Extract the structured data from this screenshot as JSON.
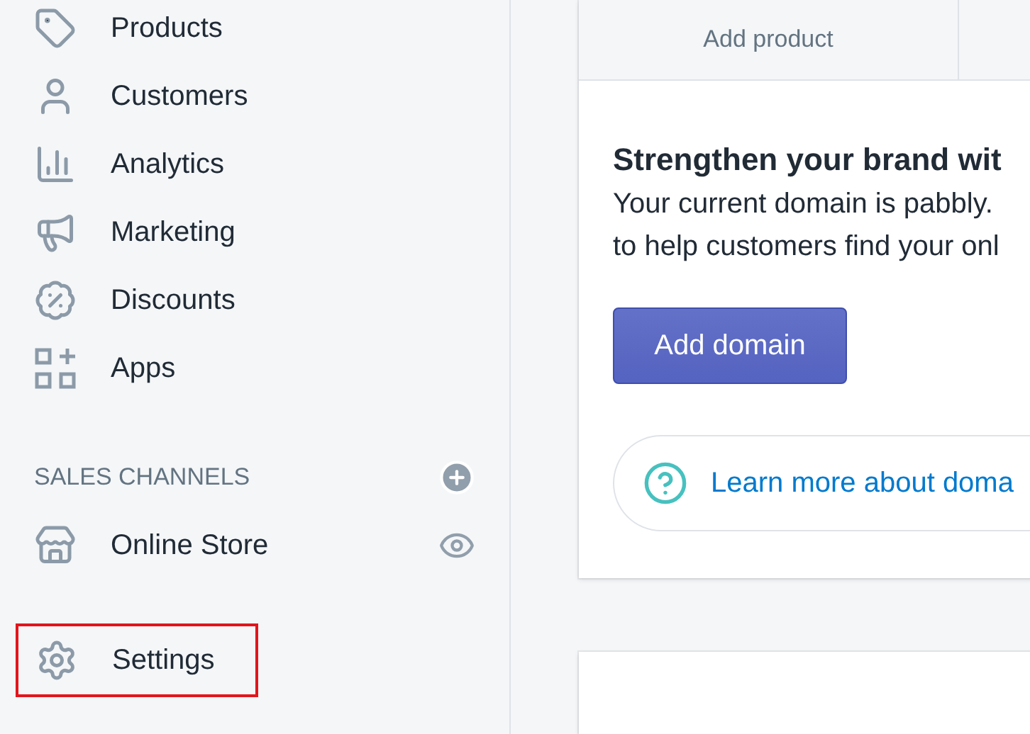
{
  "sidebar": {
    "items": [
      {
        "label": "Products"
      },
      {
        "label": "Customers"
      },
      {
        "label": "Analytics"
      },
      {
        "label": "Marketing"
      },
      {
        "label": "Discounts"
      },
      {
        "label": "Apps"
      }
    ],
    "sales_channels": {
      "heading": "SALES CHANNELS",
      "items": [
        {
          "label": "Online Store"
        }
      ]
    },
    "settings": {
      "label": "Settings",
      "highlighted": true
    }
  },
  "main": {
    "tabs": [
      {
        "label": "Add product"
      }
    ],
    "card": {
      "title": "Strengthen your brand wit",
      "lines": [
        "Your current domain is pabbly.",
        "to help customers find your onl"
      ],
      "button": "Add domain",
      "link": "Learn more about doma"
    }
  }
}
